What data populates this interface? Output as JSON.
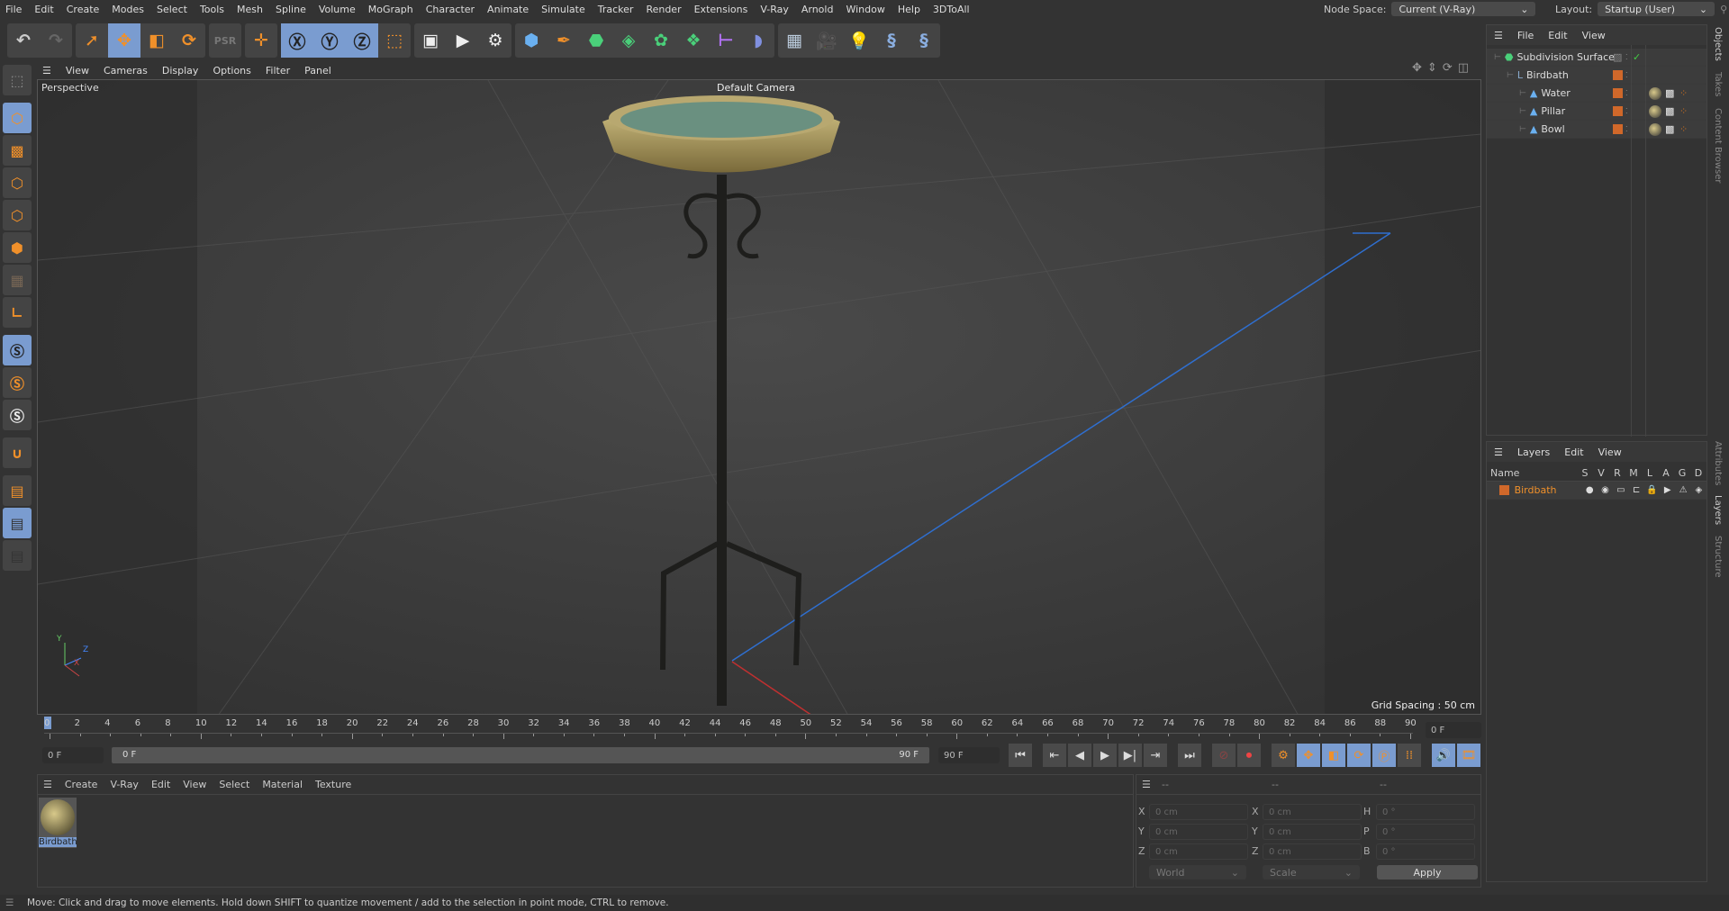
{
  "menu": [
    "File",
    "Edit",
    "Create",
    "Modes",
    "Select",
    "Tools",
    "Mesh",
    "Spline",
    "Volume",
    "MoGraph",
    "Character",
    "Animate",
    "Simulate",
    "Tracker",
    "Render",
    "Extensions",
    "V-Ray",
    "Arnold",
    "Window",
    "Help",
    "3DToAll"
  ],
  "node_space": {
    "label": "Node Space:",
    "value": "Current (V-Ray)"
  },
  "layout": {
    "label": "Layout:",
    "value": "Startup (User)"
  },
  "viewport": {
    "menu": [
      "View",
      "Cameras",
      "Display",
      "Options",
      "Filter",
      "Panel"
    ],
    "name": "Perspective",
    "camera": "Default Camera",
    "grid_spacing": "Grid Spacing : 50 cm",
    "axis": {
      "y": "Y",
      "z": "Z",
      "x": "X"
    }
  },
  "objects": {
    "menu": [
      "File",
      "Edit",
      "View"
    ],
    "tab": "Objects",
    "items": [
      {
        "name": "Subdivision Surface",
        "level": 0
      },
      {
        "name": "Birdbath",
        "level": 1
      },
      {
        "name": "Water",
        "level": 2
      },
      {
        "name": "Pillar",
        "level": 2
      },
      {
        "name": "Bowl",
        "level": 2
      }
    ]
  },
  "layers": {
    "menu": [
      "Layers",
      "Edit",
      "View"
    ],
    "columns": [
      "Name",
      "S",
      "V",
      "R",
      "M",
      "L",
      "A",
      "G",
      "D"
    ],
    "items": [
      {
        "name": "Birdbath",
        "color": "#d0682a"
      }
    ]
  },
  "side_tabs": [
    "Objects",
    "Takes",
    "Content Browser",
    "Attributes",
    "Layers",
    "Structure"
  ],
  "timeline": {
    "start": 0,
    "end": 90,
    "step": 2,
    "current_frame": "0 F",
    "range_start": "0 F",
    "range_bar_start": "0 F",
    "range_bar_end": "90 F",
    "range_end": "90 F"
  },
  "materials": {
    "menu": [
      "Create",
      "V-Ray",
      "Edit",
      "View",
      "Select",
      "Material",
      "Texture"
    ],
    "items": [
      {
        "name": "Birdbath"
      }
    ]
  },
  "coordinates": {
    "headers": [
      "--",
      "--",
      "--"
    ],
    "rows": [
      {
        "l1": "X",
        "v1": "0 cm",
        "l2": "X",
        "v2": "0 cm",
        "l3": "H",
        "v3": "0 °"
      },
      {
        "l1": "Y",
        "v1": "0 cm",
        "l2": "Y",
        "v2": "0 cm",
        "l3": "P",
        "v3": "0 °"
      },
      {
        "l1": "Z",
        "v1": "0 cm",
        "l2": "Z",
        "v2": "0 cm",
        "l3": "B",
        "v3": "0 °"
      }
    ],
    "space": "World",
    "mode": "Scale",
    "apply": "Apply"
  },
  "status": "Move: Click and drag to move elements. Hold down SHIFT to quantize movement / add to the selection in point mode, CTRL to remove.",
  "colors": {
    "accent": "#f0902a",
    "selected": "#7a9cd0",
    "layer": "#d0682a"
  }
}
